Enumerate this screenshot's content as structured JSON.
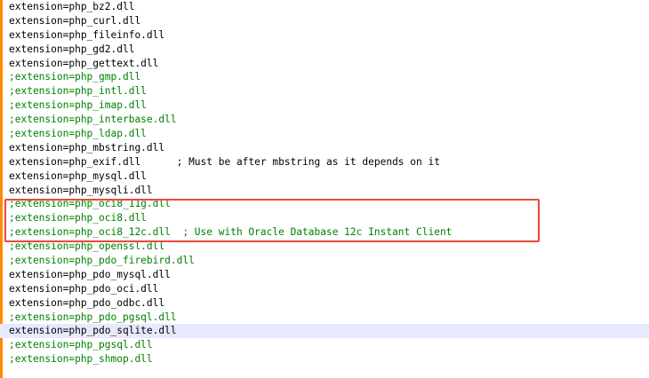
{
  "editor": {
    "lines": [
      {
        "text": "extension=php_bz2.dll",
        "comment": false
      },
      {
        "text": "extension=php_curl.dll",
        "comment": false
      },
      {
        "text": "extension=php_fileinfo.dll",
        "comment": false
      },
      {
        "text": "extension=php_gd2.dll",
        "comment": false
      },
      {
        "text": "extension=php_gettext.dll",
        "comment": false
      },
      {
        "text": ";extension=php_gmp.dll",
        "comment": true
      },
      {
        "text": ";extension=php_intl.dll",
        "comment": true
      },
      {
        "text": ";extension=php_imap.dll",
        "comment": true
      },
      {
        "text": ";extension=php_interbase.dll",
        "comment": true
      },
      {
        "text": ";extension=php_ldap.dll",
        "comment": true
      },
      {
        "text": "extension=php_mbstring.dll",
        "comment": false
      },
      {
        "text": "extension=php_exif.dll      ; Must be after mbstring as it depends on it",
        "comment": false
      },
      {
        "text": "extension=php_mysql.dll",
        "comment": false
      },
      {
        "text": "extension=php_mysqli.dll",
        "comment": false
      },
      {
        "text": ";extension=php_oci8_11g.dll",
        "comment": true
      },
      {
        "text": ";extension=php_oci8.dll",
        "comment": true
      },
      {
        "text": ";extension=php_oci8_12c.dll  ; Use with Oracle Database 12c Instant Client",
        "comment": true
      },
      {
        "text": ";extension=php_openssl.dll",
        "comment": true
      },
      {
        "text": ";extension=php_pdo_firebird.dll",
        "comment": true
      },
      {
        "text": "extension=php_pdo_mysql.dll",
        "comment": false
      },
      {
        "text": "extension=php_pdo_oci.dll",
        "comment": false
      },
      {
        "text": "extension=php_pdo_odbc.dll",
        "comment": false
      },
      {
        "text": ";extension=php_pdo_pgsql.dll",
        "comment": true
      },
      {
        "text": "extension=php_pdo_sqlite.dll",
        "comment": false,
        "current": true
      },
      {
        "text": ";extension=php_pgsql.dll",
        "comment": true
      },
      {
        "text": ";extension=php_shmop.dll",
        "comment": true
      }
    ]
  },
  "colors": {
    "code": "#000000",
    "comment": "#008000",
    "current_line": "#e8e8ff",
    "highlight_box": "#e8483c",
    "margin": "#ff8a00"
  }
}
